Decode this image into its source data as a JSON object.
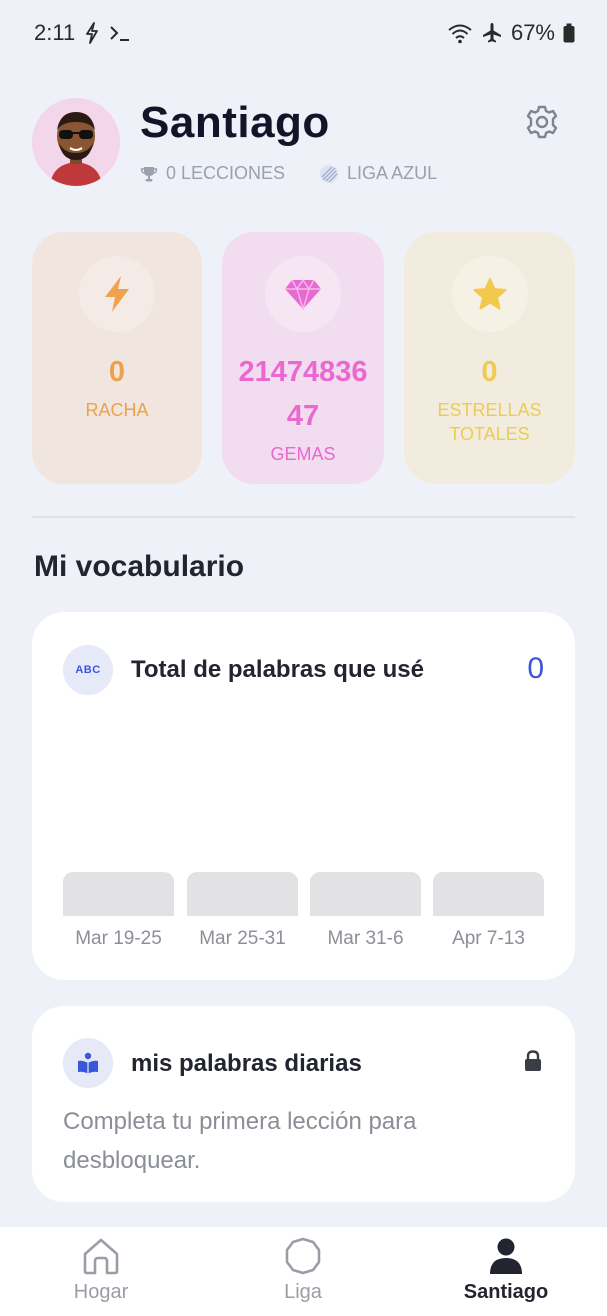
{
  "status_bar": {
    "time": "2:11",
    "battery": "67%"
  },
  "profile": {
    "name": "Santiago",
    "lessons": "0 LECCIONES",
    "league": "LIGA AZUL"
  },
  "stats": [
    {
      "value": "0",
      "label": "RACHA",
      "icon": "lightning-icon"
    },
    {
      "value": "2147483647",
      "label": "GEMAS",
      "icon": "gem-icon"
    },
    {
      "value": "0",
      "label": "ESTRELLAS TOTALES",
      "icon": "star-icon"
    }
  ],
  "vocabulary": {
    "section_title": "Mi vocabulario",
    "badge_text": "ABC",
    "card_title": "Total de palabras que usé",
    "count": "0",
    "bars": [
      {
        "label": "Mar 19-25",
        "value": 0
      },
      {
        "label": "Mar 25-31",
        "value": 0
      },
      {
        "label": "Mar 31-6",
        "value": 0
      },
      {
        "label": "Apr 7-13",
        "value": 0
      }
    ]
  },
  "daily_words": {
    "title": "mis palabras diarias",
    "description": "Completa tu primera lección para desbloquear."
  },
  "nav": {
    "items": [
      {
        "label": "Hogar",
        "icon": "home-icon"
      },
      {
        "label": "Liga",
        "icon": "league-icon"
      },
      {
        "label": "Santiago",
        "icon": "profile-icon"
      }
    ],
    "active": "Santiago"
  },
  "colors": {
    "background": "#eef1f7",
    "accent_blue": "#3a57d8",
    "racha": "#eda14a",
    "gemas": "#ea68cf",
    "estrellas": "#eecb55"
  }
}
